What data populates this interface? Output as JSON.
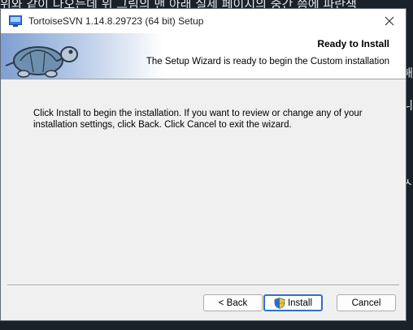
{
  "background": {
    "top_text": "위와 같이 나오는데 위 그림의 맨 아래 실제 페이지의 중간 쯤에 파란색",
    "edge_chars": [
      "해",
      "니",
      "ㅅ"
    ]
  },
  "window": {
    "title": "TortoiseSVN 1.14.8.29723 (64 bit) Setup",
    "close_label": "✕"
  },
  "header": {
    "title": "Ready to Install",
    "subtitle": "The Setup Wizard is ready to begin the Custom installation"
  },
  "body": {
    "text": "Click Install to begin the installation. If you want to review or change any of your installation settings, click Back. Click Cancel to exit the wizard."
  },
  "buttons": {
    "back": "< Back",
    "install": "Install",
    "cancel": "Cancel"
  },
  "colors": {
    "accent": "#2f72c8",
    "dialog_bg": "#f0f0f0",
    "desktop_bg": "#1b2129"
  },
  "icons": {
    "app": "tortoisesvn-icon",
    "banner": "turtle-icon",
    "install": "uac-shield-icon",
    "close": "close-icon"
  }
}
